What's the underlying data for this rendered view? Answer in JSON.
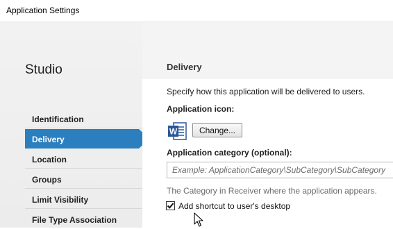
{
  "window": {
    "title": "Application Settings"
  },
  "sidebar": {
    "brand": "Studio",
    "items": [
      {
        "label": "Identification"
      },
      {
        "label": "Delivery",
        "active": true
      },
      {
        "label": "Location"
      },
      {
        "label": "Groups"
      },
      {
        "label": "Limit Visibility"
      },
      {
        "label": "File Type Association"
      }
    ]
  },
  "main": {
    "section_title": "Delivery",
    "description": "Specify how this application will be delivered to users.",
    "icon_label": "Application icon:",
    "icon_name": "word-app-icon",
    "change_button": "Change...",
    "category_label": "Application category (optional):",
    "category_placeholder": "Example: ApplicationCategory\\SubCategory\\SubCategory",
    "category_value": "",
    "category_hint": "The Category in Receiver where the application appears.",
    "shortcut_label": "Add shortcut to user's desktop",
    "shortcut_checked": true
  },
  "colors": {
    "accent": "#2b7fbf",
    "word_blue": "#2b579a"
  }
}
